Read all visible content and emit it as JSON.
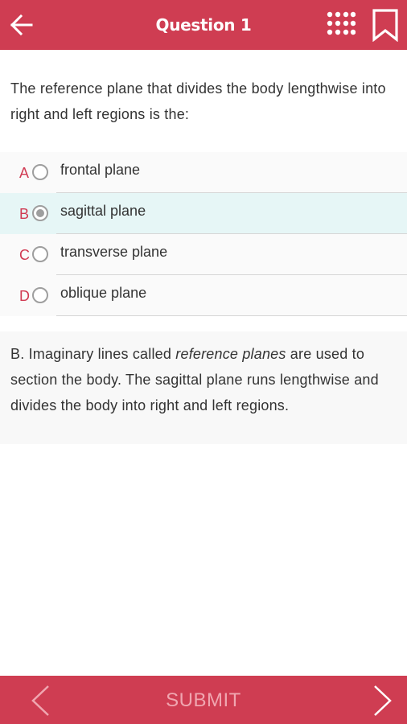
{
  "header": {
    "title": "Question 1",
    "back_icon": "arrow-left-icon",
    "grid_icon": "dots-grid-icon",
    "bookmark_icon": "bookmark-icon",
    "color": "#cf3d52"
  },
  "question": {
    "text": "The reference plane that divides the body lengthwise into right and left regions is the:"
  },
  "options": [
    {
      "letter": "A",
      "text": "frontal plane",
      "selected": false
    },
    {
      "letter": "B",
      "text": "sagittal plane",
      "selected": true
    },
    {
      "letter": "C",
      "text": "transverse plane",
      "selected": false
    },
    {
      "letter": "D",
      "text": "oblique plane",
      "selected": false
    }
  ],
  "explanation": {
    "before": "B. Imaginary lines called ",
    "italic": "reference planes",
    "after": " are used to section the body. The sagittal plane runs lengthwise and divides the body into right and left regions."
  },
  "footer": {
    "submit_label": "SUBMIT",
    "prev_icon": "chevron-left-icon",
    "next_icon": "chevron-right-icon"
  },
  "colors": {
    "accent": "#cf3d52",
    "selected_bg": "#e6f6f6"
  }
}
